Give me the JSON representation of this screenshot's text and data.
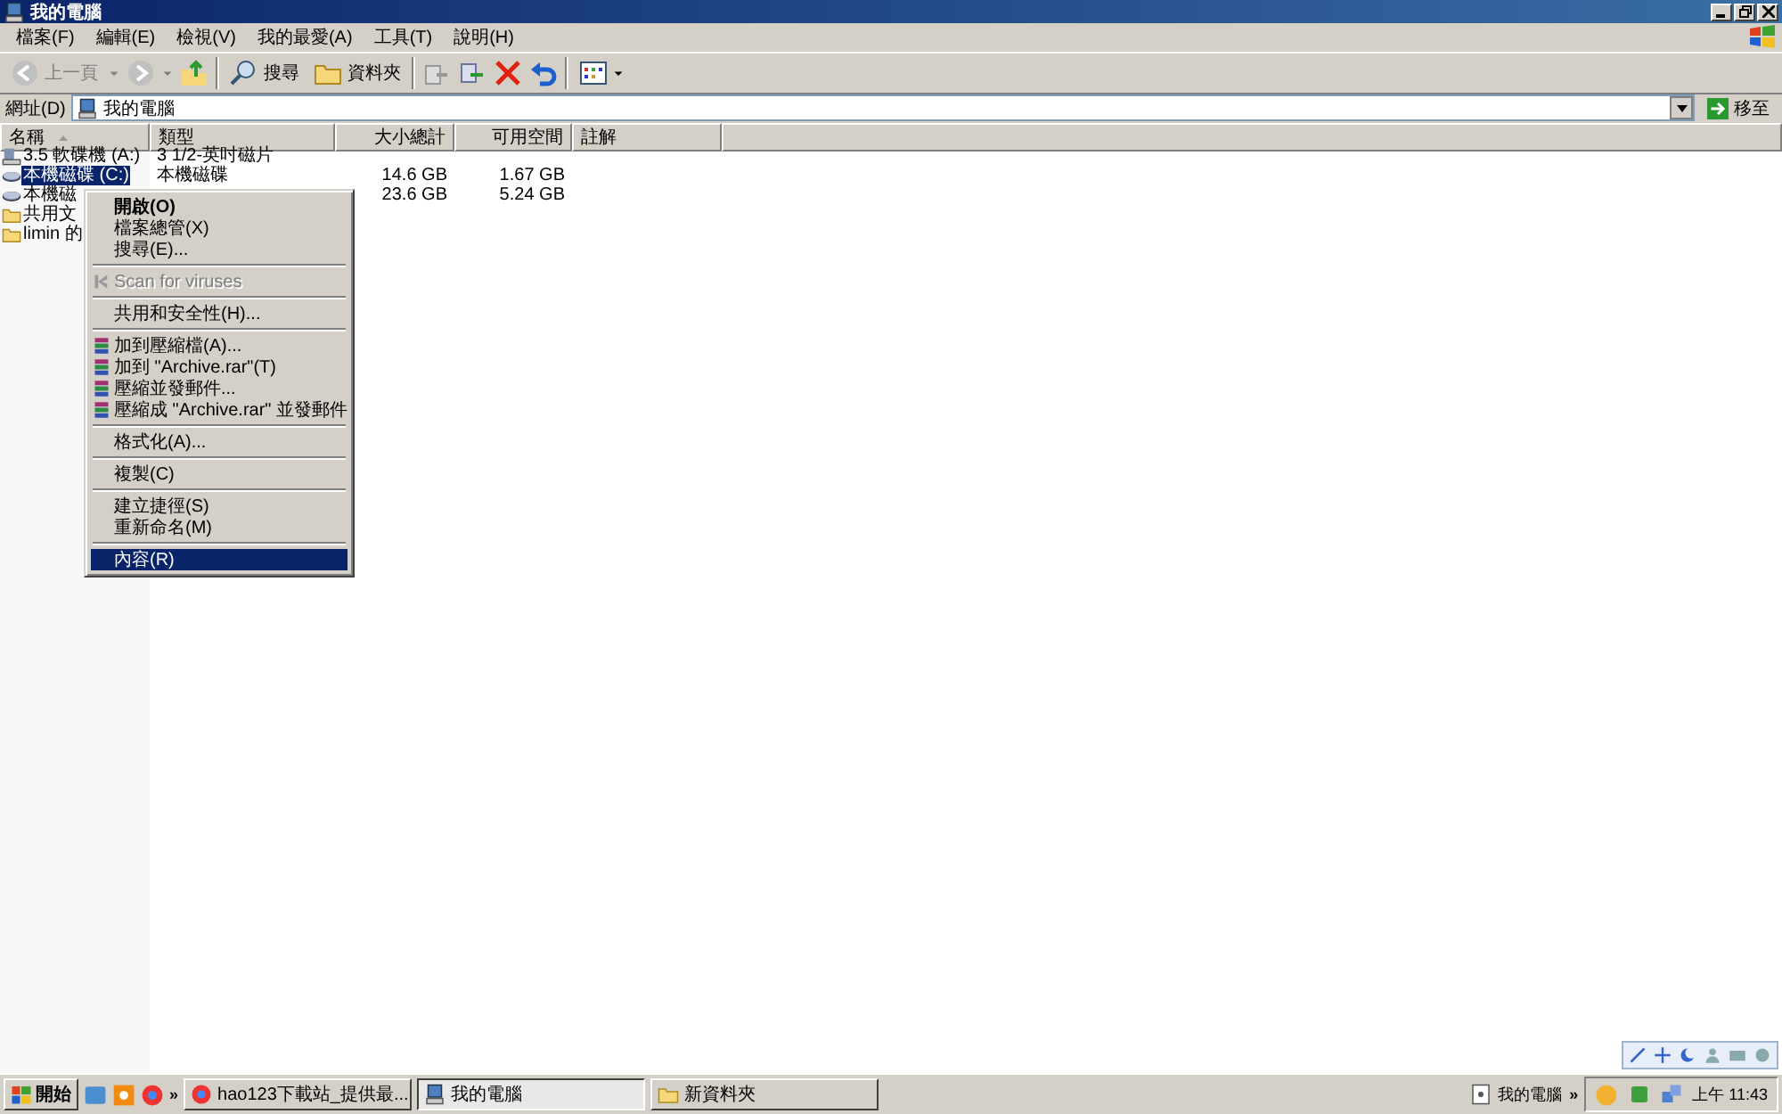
{
  "window": {
    "title": "我的電腦"
  },
  "menu_bar": [
    "檔案(F)",
    "編輯(E)",
    "檢視(V)",
    "我的最愛(A)",
    "工具(T)",
    "說明(H)"
  ],
  "toolbar": {
    "back": "上一頁",
    "search": "搜尋",
    "folders": "資料夾"
  },
  "address_bar": {
    "label": "網址(D)",
    "value": "我的電腦",
    "go": "移至"
  },
  "table": {
    "columns": [
      "名稱",
      "類型",
      "大小總計",
      "可用空間",
      "註解"
    ],
    "rows": [
      {
        "kind": "floppy",
        "name": "3.5 軟碟機 (A:)",
        "type": "3 1/2-英吋磁片",
        "size": "",
        "free": "",
        "selected": false
      },
      {
        "kind": "disk",
        "name": "本機磁碟 (C:)",
        "type": "本機磁碟",
        "size": "14.6 GB",
        "free": "1.67 GB",
        "selected": true
      },
      {
        "kind": "disk",
        "name": "本機磁",
        "type": "",
        "size": "23.6 GB",
        "free": "5.24 GB",
        "selected": false
      },
      {
        "kind": "folder",
        "name": "共用文",
        "type": "",
        "size": "",
        "free": "",
        "selected": false
      },
      {
        "kind": "folder",
        "name": "limin 的",
        "type": "",
        "size": "",
        "free": "",
        "selected": false
      }
    ]
  },
  "context_menu": [
    {
      "kind": "item",
      "label": "開啟(O)",
      "default": true,
      "disabled": false,
      "selected": false
    },
    {
      "kind": "item",
      "label": "檔案總管(X)",
      "default": false,
      "disabled": false,
      "selected": false
    },
    {
      "kind": "item",
      "label": "搜尋(E)...",
      "default": false,
      "disabled": false,
      "selected": false
    },
    {
      "kind": "separator"
    },
    {
      "kind": "scan-item",
      "label": "Scan for viruses",
      "default": false,
      "disabled": true,
      "selected": false
    },
    {
      "kind": "separator"
    },
    {
      "kind": "item",
      "label": "共用和安全性(H)...",
      "default": false,
      "disabled": false,
      "selected": false
    },
    {
      "kind": "separator"
    },
    {
      "kind": "rar-item",
      "label": "加到壓縮檔(A)...",
      "default": false,
      "disabled": false,
      "selected": false
    },
    {
      "kind": "rar-item",
      "label": "加到 \"Archive.rar\"(T)",
      "default": false,
      "disabled": false,
      "selected": false
    },
    {
      "kind": "rar-item",
      "label": "壓縮並發郵件...",
      "default": false,
      "disabled": false,
      "selected": false
    },
    {
      "kind": "rar-item",
      "label": "壓縮成 \"Archive.rar\" 並發郵件",
      "default": false,
      "disabled": false,
      "selected": false
    },
    {
      "kind": "separator"
    },
    {
      "kind": "item",
      "label": "格式化(A)...",
      "default": false,
      "disabled": false,
      "selected": false
    },
    {
      "kind": "separator"
    },
    {
      "kind": "item",
      "label": "複製(C)",
      "default": false,
      "disabled": false,
      "selected": false
    },
    {
      "kind": "separator"
    },
    {
      "kind": "item",
      "label": "建立捷徑(S)",
      "default": false,
      "disabled": false,
      "selected": false
    },
    {
      "kind": "item",
      "label": "重新命名(M)",
      "default": false,
      "disabled": false,
      "selected": false
    },
    {
      "kind": "separator"
    },
    {
      "kind": "item",
      "label": "內容(R)",
      "default": false,
      "disabled": false,
      "selected": true
    }
  ],
  "taskbar": {
    "start": "開始",
    "more": "»",
    "tasks": [
      {
        "kind": "browser",
        "label": "hao123下載站_提供最...",
        "selected": false
      },
      {
        "kind": "computer",
        "label": "我的電腦",
        "selected": true
      },
      {
        "kind": "folder",
        "label": "新資料夾",
        "selected": false
      }
    ],
    "deskband": "我的電腦",
    "deskband_more": "»",
    "clock": "上午 11:43"
  }
}
